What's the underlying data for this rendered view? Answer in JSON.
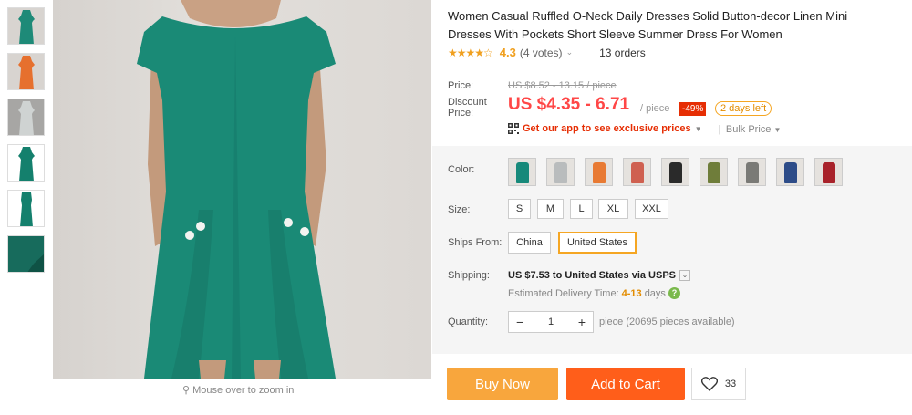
{
  "gallery": {
    "thumbnails": [
      {
        "color": "#1e8a78",
        "bg": "#d8d4d0"
      },
      {
        "color": "#e6702e",
        "bg": "#d8d4d0"
      },
      {
        "color": "#cfd3d2",
        "bg": "#a7a6a4"
      },
      {
        "color": "#14806d",
        "bg": "#ffffff"
      },
      {
        "color": "#14806d",
        "bg": "#ffffff"
      },
      {
        "color": "#176b5c",
        "bg": "#1f7a6a"
      }
    ],
    "main_color": "#1a8a76",
    "zoom_hint": "Mouse over to zoom in"
  },
  "product": {
    "title": "Women Casual Ruffled O-Neck Daily Dresses Solid Button-decor Linen Mini Dresses With Pockets Short Sleeve Summer Dress For Women",
    "stars": "★★★★☆",
    "rating": "4.3",
    "votes": "(4 votes)",
    "orders": "13 orders"
  },
  "pricing": {
    "price_label": "Price:",
    "old_price": "US $8.52 - 13.15 / piece",
    "discount_label_1": "Discount",
    "discount_label_2": "Price:",
    "current_price": "US $4.35 - 6.71",
    "per_piece": "/ piece",
    "discount_badge": "-49%",
    "days_left": "2 days left",
    "app_promo": "Get our app to see exclusive prices",
    "bulk_price": "Bulk Price"
  },
  "options": {
    "color_label": "Color:",
    "colors": [
      "#17897a",
      "#b9bcbd",
      "#e87a33",
      "#cf6050",
      "#2a2a2a",
      "#6f7d3a",
      "#7a7a76",
      "#2d4c88",
      "#a8222a"
    ],
    "size_label": "Size:",
    "sizes": [
      "S",
      "M",
      "L",
      "XL",
      "XXL"
    ],
    "ships_from_label": "Ships From:",
    "ships_from": [
      "China",
      "United States"
    ],
    "ships_from_selected": "United States"
  },
  "shipping": {
    "label": "Shipping:",
    "cost_text": "US $7.53 to United States via USPS",
    "delivery_prefix": "Estimated Delivery Time:",
    "delivery_days": "4-13",
    "delivery_suffix": "days"
  },
  "quantity": {
    "label": "Quantity:",
    "value": "1",
    "minus": "−",
    "plus": "+",
    "available": "piece (20695 pieces available)"
  },
  "actions": {
    "buy_now": "Buy Now",
    "add_to_cart": "Add to Cart",
    "wishlist_count": "33"
  }
}
